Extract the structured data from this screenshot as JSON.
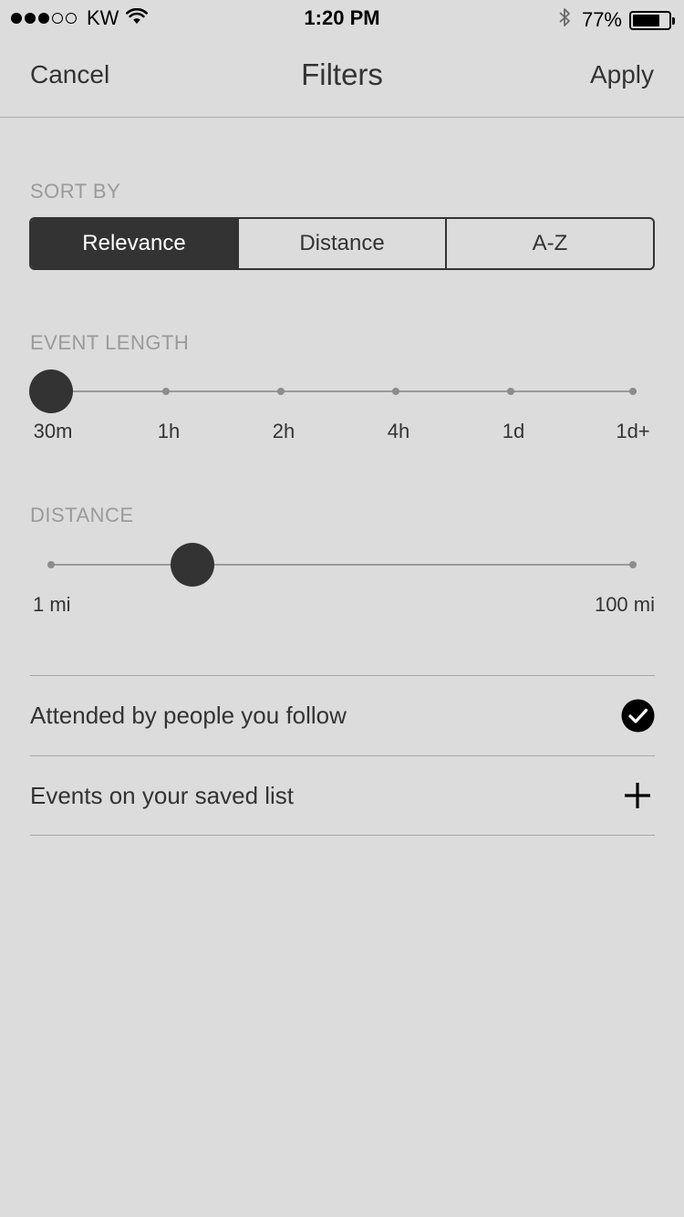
{
  "status_bar": {
    "signal_full": 3,
    "signal_empty": 2,
    "carrier": "KW",
    "time": "1:20 PM",
    "battery_pct": "77%",
    "battery_level": 0.77,
    "icons": [
      "wifi-icon",
      "bluetooth-icon",
      "battery-icon"
    ]
  },
  "nav": {
    "cancel": "Cancel",
    "title": "Filters",
    "apply": "Apply"
  },
  "sort_by": {
    "label": "SORT BY",
    "options": [
      "Relevance",
      "Distance",
      "A-Z"
    ],
    "selected": "Relevance"
  },
  "event_length": {
    "label": "EVENT LENGTH",
    "stops": [
      "30m",
      "1h",
      "2h",
      "4h",
      "1d",
      "1d+"
    ],
    "value": "30m"
  },
  "distance": {
    "label": "DISTANCE",
    "min_label": "1 mi",
    "max_label": "100 mi",
    "min": 1,
    "max": 100,
    "value": 25
  },
  "options": [
    {
      "label": "Attended by people you follow",
      "icon": "checkmark-circle-icon",
      "checked": true
    },
    {
      "label": "Events on your saved list",
      "icon": "plus-icon",
      "checked": false
    }
  ],
  "colors": {
    "background": "#dcdcdc",
    "accent": "#333333",
    "muted": "#9a9a9a"
  }
}
